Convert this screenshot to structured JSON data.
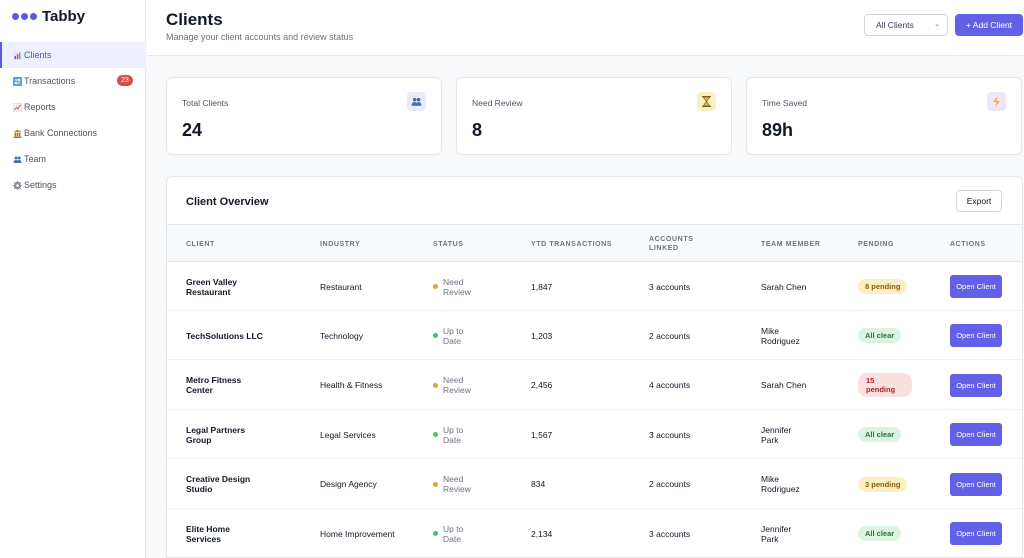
{
  "app": {
    "name": "Tabby"
  },
  "colors": {
    "accent": "#6360e8",
    "badge_red": "#dc4a4a",
    "warning_dot": "#e0a33b",
    "ok_dot": "#4fbf6b"
  },
  "sidebar": {
    "items": [
      {
        "label": "Clients",
        "icon": "bar-chart-icon",
        "active": true
      },
      {
        "label": "Transactions",
        "icon": "transfer-icon",
        "badge": "23"
      },
      {
        "label": "Reports",
        "icon": "line-chart-icon"
      },
      {
        "label": "Bank Connections",
        "icon": "bank-icon"
      },
      {
        "label": "Team",
        "icon": "people-icon"
      },
      {
        "label": "Settings",
        "icon": "gear-icon"
      }
    ]
  },
  "header": {
    "title": "Clients",
    "subtitle": "Manage your client accounts and review status",
    "filter_value": "All Clients",
    "add_label": "+ Add Client"
  },
  "stats": [
    {
      "label": "Total Clients",
      "value": "24",
      "icon": "people-icon"
    },
    {
      "label": "Need Review",
      "value": "8",
      "icon": "hourglass-icon"
    },
    {
      "label": "Time Saved",
      "value": "89h",
      "icon": "lightning-icon"
    }
  ],
  "overview": {
    "title": "Client Overview",
    "export_label": "Export",
    "columns": [
      "CLIENT",
      "INDUSTRY",
      "STATUS",
      "YTD TRANSACTIONS",
      "ACCOUNTS LINKED",
      "TEAM MEMBER",
      "PENDING",
      "ACTIONS"
    ],
    "action_label": "Open Client",
    "rows": [
      {
        "client": "Green Valley Restaurant",
        "industry": "Restaurant",
        "status": "Need Review",
        "ytd": "1,847",
        "accounts": "3 accounts",
        "member": "Sarah Chen",
        "pending": "8 pending",
        "pending_type": "warn"
      },
      {
        "client": "TechSolutions LLC",
        "industry": "Technology",
        "status": "Up to Date",
        "ytd": "1,203",
        "accounts": "2 accounts",
        "member": "Mike Rodriguez",
        "pending": "All clear",
        "pending_type": "ok"
      },
      {
        "client": "Metro Fitness Center",
        "industry": "Health & Fitness",
        "status": "Need Review",
        "ytd": "2,456",
        "accounts": "4 accounts",
        "member": "Sarah Chen",
        "pending": "15 pending",
        "pending_type": "danger"
      },
      {
        "client": "Legal Partners Group",
        "industry": "Legal Services",
        "status": "Up to Date",
        "ytd": "1,567",
        "accounts": "3 accounts",
        "member": "Jennifer Park",
        "pending": "All clear",
        "pending_type": "ok"
      },
      {
        "client": "Creative Design Studio",
        "industry": "Design Agency",
        "status": "Need Review",
        "ytd": "834",
        "accounts": "2 accounts",
        "member": "Mike Rodriguez",
        "pending": "3 pending",
        "pending_type": "warn"
      },
      {
        "client": "Elite Home Services",
        "industry": "Home Improvement",
        "status": "Up to Date",
        "ytd": "2,134",
        "accounts": "3 accounts",
        "member": "Jennifer Park",
        "pending": "All clear",
        "pending_type": "ok"
      }
    ]
  }
}
